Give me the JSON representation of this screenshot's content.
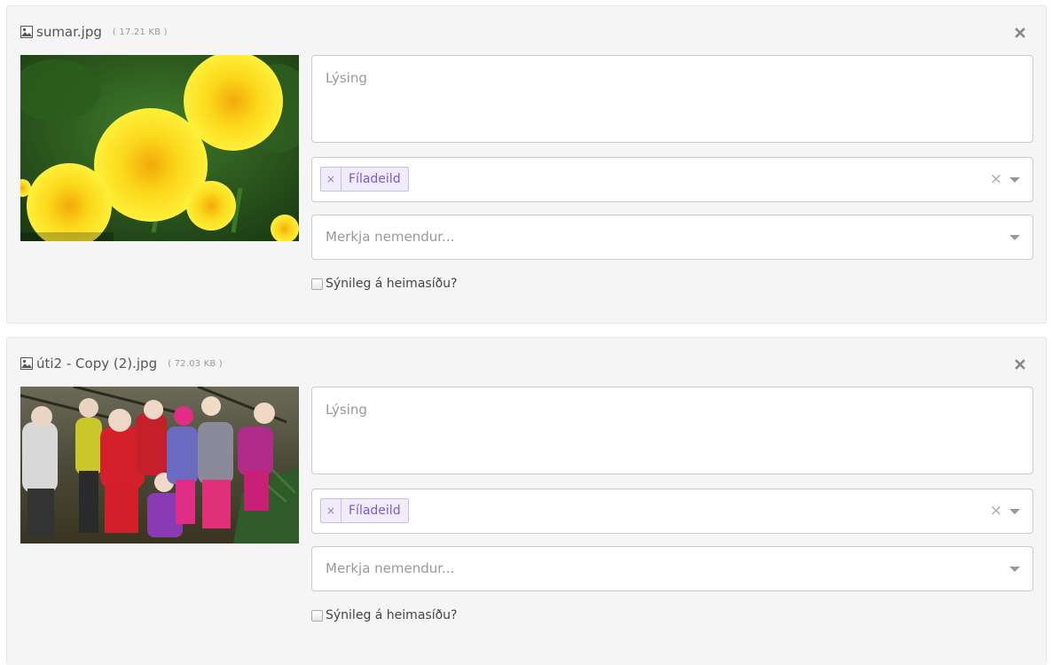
{
  "items": [
    {
      "filename": "sumar.jpg",
      "size": "( 17.21 KB )",
      "photo_icon": "image-file-icon",
      "remove_icon": "close-icon",
      "description_placeholder": "Lýsing",
      "department_tag": "Fíladeild",
      "tag_remove_glyph": "×",
      "clear_glyph": "×",
      "students_placeholder": "Merkja nemendur...",
      "visible_label": "Sýnileg á heimasíðu?",
      "visible_checked": false
    },
    {
      "filename": "úti2 - Copy (2).jpg",
      "size": "( 72.03 KB )",
      "photo_icon": "image-file-icon",
      "remove_icon": "close-icon",
      "description_placeholder": "Lýsing",
      "department_tag": "Fíladeild",
      "tag_remove_glyph": "×",
      "clear_glyph": "×",
      "students_placeholder": "Merkja nemendur...",
      "visible_label": "Sýnileg á heimasíðu?",
      "visible_checked": false
    }
  ],
  "colors": {
    "tag_text": "#7a5bd0",
    "tag_bg": "#f0ecfa",
    "card_bg": "#f5f5f5"
  }
}
